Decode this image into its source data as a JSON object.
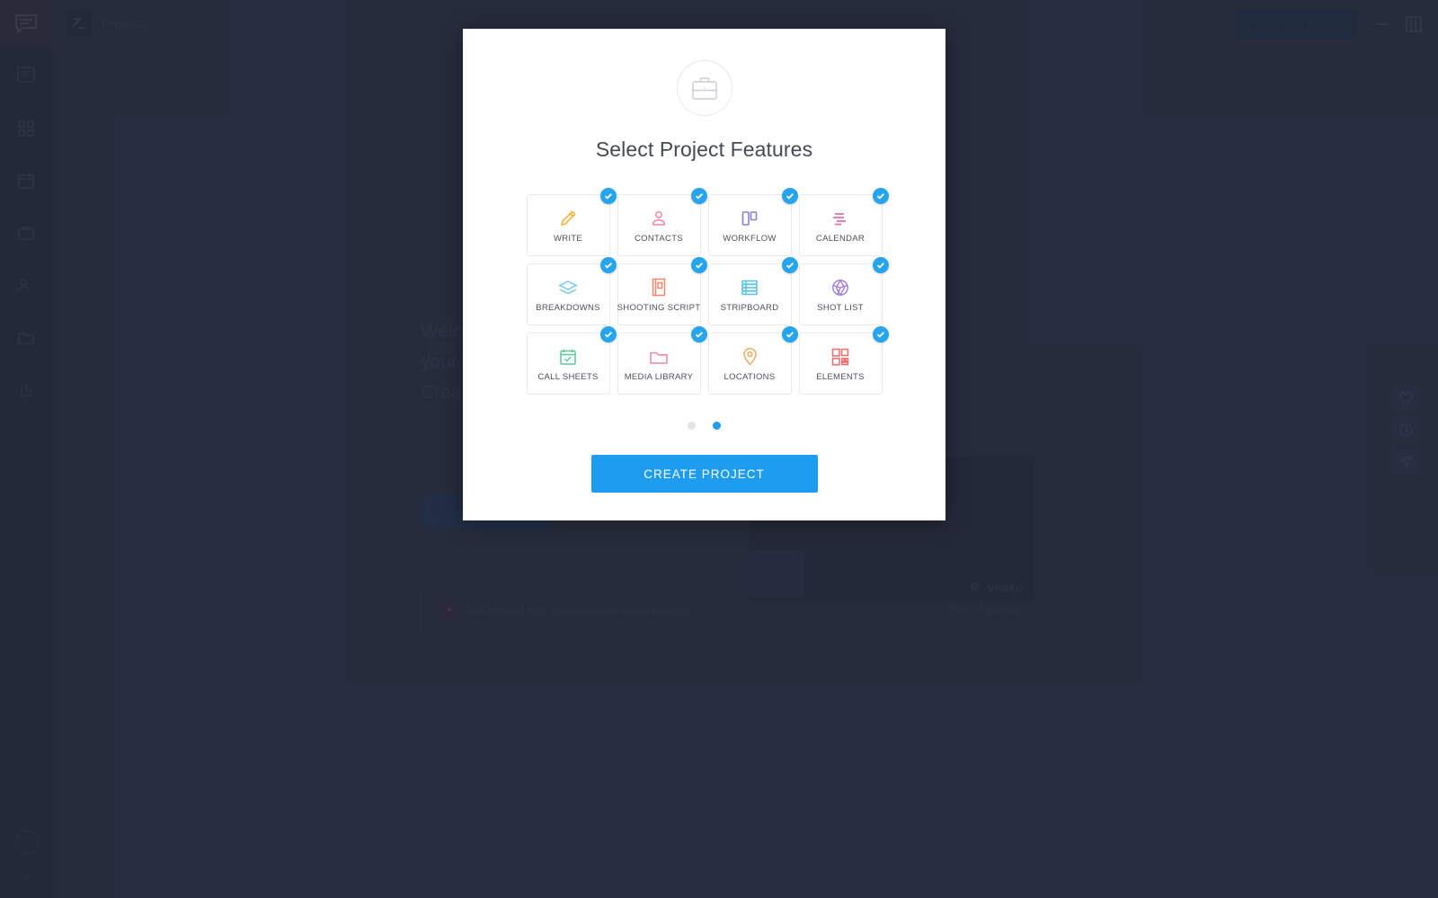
{
  "app": {
    "rail": {
      "top_icon": "chat-bubble-icon",
      "items": [
        {
          "icon": "list-icon"
        },
        {
          "icon": "grid-icon"
        },
        {
          "icon": "calendar-icon"
        },
        {
          "icon": "briefcase-icon"
        },
        {
          "icon": "users-icon"
        },
        {
          "icon": "folder-icon"
        },
        {
          "icon": "chart-icon"
        }
      ],
      "bottom": [
        {
          "icon": "avatar-icon"
        },
        {
          "icon": "settings-icon"
        }
      ]
    },
    "topbar": {
      "logo_icon": "studiobinder-logo-icon",
      "breadcrumb": "Projects",
      "new_project_label": "NEW PROJECT",
      "icons": [
        "help-icon",
        "apps-grid-icon"
      ]
    },
    "content": {
      "welcome_icon": "document-stack-icon",
      "welcome_lines": [
        "Welcome to StudioBinder,",
        "your production",
        "Create a project to"
      ],
      "cta_label": "",
      "video": {
        "play_icon": "play-icon",
        "brand": "vimeo",
        "settings_icon": "gear-icon"
      },
      "tutorials": {
        "play_icon": "youtube-play-icon",
        "text": "Get started with StudioBinder video tutorials",
        "link": "View Tutorials"
      },
      "fabs": [
        {
          "icon": "heart-icon"
        },
        {
          "icon": "clock-icon"
        },
        {
          "icon": "send-icon"
        }
      ]
    }
  },
  "modal": {
    "header_icon": "briefcase-icon",
    "title": "Select Project Features",
    "features": [
      {
        "label": "WRITE",
        "icon": "pencil-icon",
        "color": "#f5b335",
        "checked": true
      },
      {
        "label": "CONTACTS",
        "icon": "contacts-icon",
        "color": "#f2849e",
        "checked": true
      },
      {
        "label": "WORKFLOW",
        "icon": "workflow-icon",
        "color": "#8b7fd4",
        "checked": true
      },
      {
        "label": "CALENDAR",
        "icon": "calendar-bars-icon",
        "color": "#e86fa8",
        "checked": true
      },
      {
        "label": "BREAKDOWNS",
        "icon": "layers-icon",
        "color": "#79c8ea",
        "checked": true
      },
      {
        "label": "SHOOTING SCRIPT",
        "icon": "script-icon",
        "color": "#f4846a",
        "checked": true
      },
      {
        "label": "STRIPBOARD",
        "icon": "stripboard-icon",
        "color": "#4fc3e8",
        "checked": true
      },
      {
        "label": "SHOT LIST",
        "icon": "aperture-icon",
        "color": "#a07ad6",
        "checked": true
      },
      {
        "label": "CALL SHEETS",
        "icon": "call-sheet-icon",
        "color": "#5fc99a",
        "checked": true
      },
      {
        "label": "MEDIA LIBRARY",
        "icon": "folder-icon",
        "color": "#ef8aa8",
        "checked": true
      },
      {
        "label": "LOCATIONS",
        "icon": "map-pin-icon",
        "color": "#f0a95e",
        "checked": true
      },
      {
        "label": "ELEMENTS",
        "icon": "elements-grid-icon",
        "color": "#f06a6a",
        "checked": true
      }
    ],
    "pagination": {
      "total": 2,
      "active_index": 1
    },
    "create_label": "CREATE PROJECT",
    "accent_color": "#1e9cf0",
    "check_color": "#26a4ee"
  }
}
